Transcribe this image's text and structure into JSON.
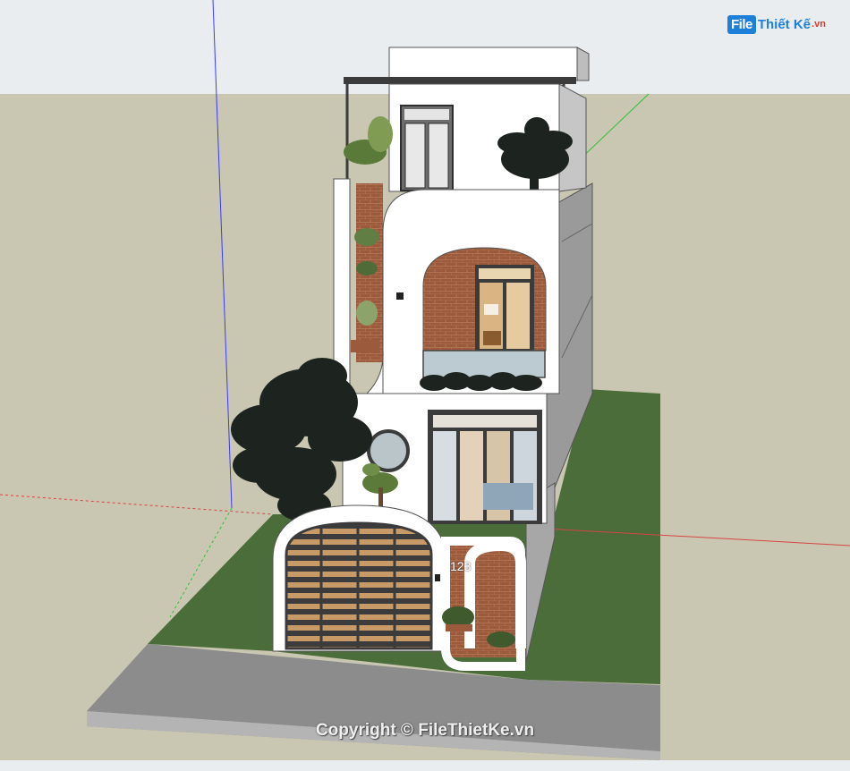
{
  "watermark": {
    "logo_prefix": "File",
    "logo_name": "Thiết Kế",
    "logo_tld": ".vn",
    "copyright": "Copyright © FileThietKe.vn"
  },
  "model": {
    "house_number": "123"
  },
  "colors": {
    "sky": "#e9edf0",
    "ground": "#c9c7b1",
    "lawn": "#4b6d3a",
    "road": "#8c8c8c",
    "wall": "#ffffff",
    "brick": "#9c5a3c",
    "frame": "#3b3b3b",
    "foliage": "#1d241f",
    "axis_blue": "#3a3aff",
    "axis_red": "#d64545",
    "axis_green": "#2fbf3a"
  }
}
